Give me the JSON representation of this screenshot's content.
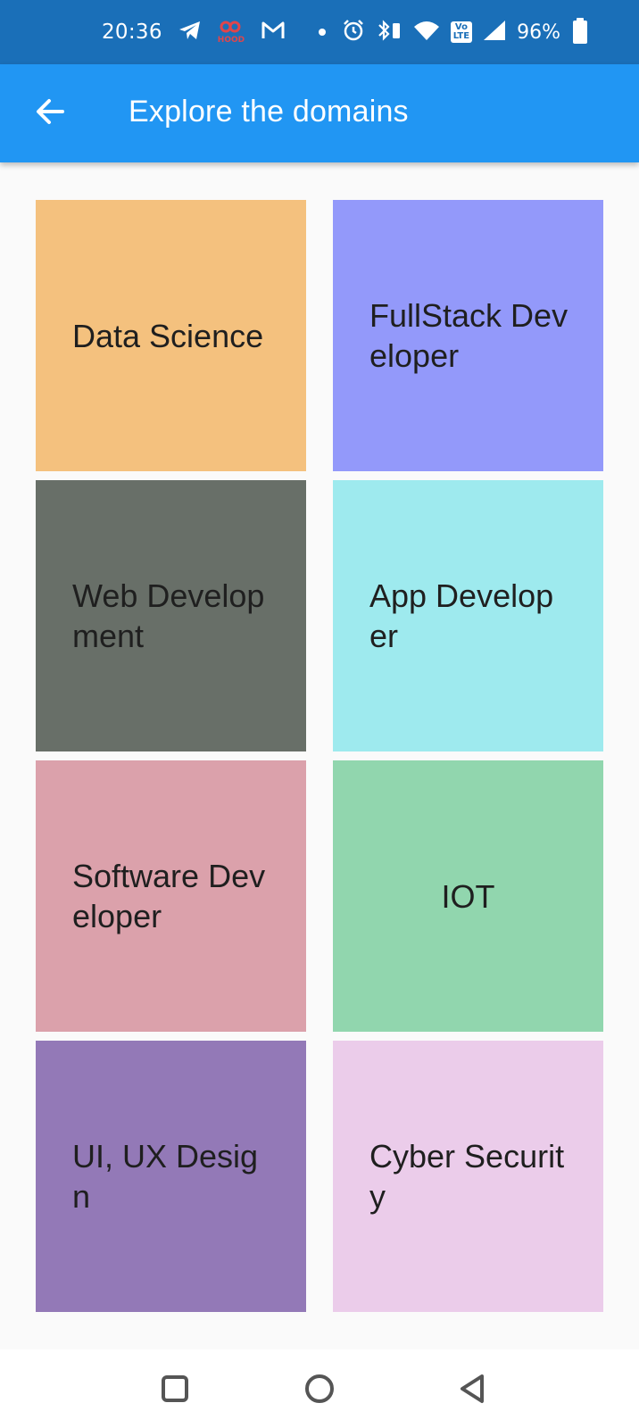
{
  "status_bar": {
    "time": "20:36",
    "hood_label": "HOOD",
    "volte_top": "Vo",
    "volte_bottom": "LTE",
    "battery": "96%"
  },
  "app_bar": {
    "title": "Explore the domains",
    "back_icon": "arrow-back-icon"
  },
  "domains": [
    {
      "label": "Data Science",
      "color": "#f4c17e"
    },
    {
      "label": "FullStack Developer",
      "color": "#9399fa"
    },
    {
      "label": "Web Development",
      "color": "#686f68"
    },
    {
      "label": "App Developer",
      "color": "#9eeaee"
    },
    {
      "label": "Software Developer",
      "color": "#dba1ab"
    },
    {
      "label": "IOT",
      "color": "#91d6ae"
    },
    {
      "label": "UI, UX Design",
      "color": "#9379b7"
    },
    {
      "label": "Cyber Security",
      "color": "#ebccea"
    }
  ],
  "nav_bar": {
    "recents_icon": "square-icon",
    "home_icon": "circle-icon",
    "back_icon": "triangle-back-icon"
  }
}
